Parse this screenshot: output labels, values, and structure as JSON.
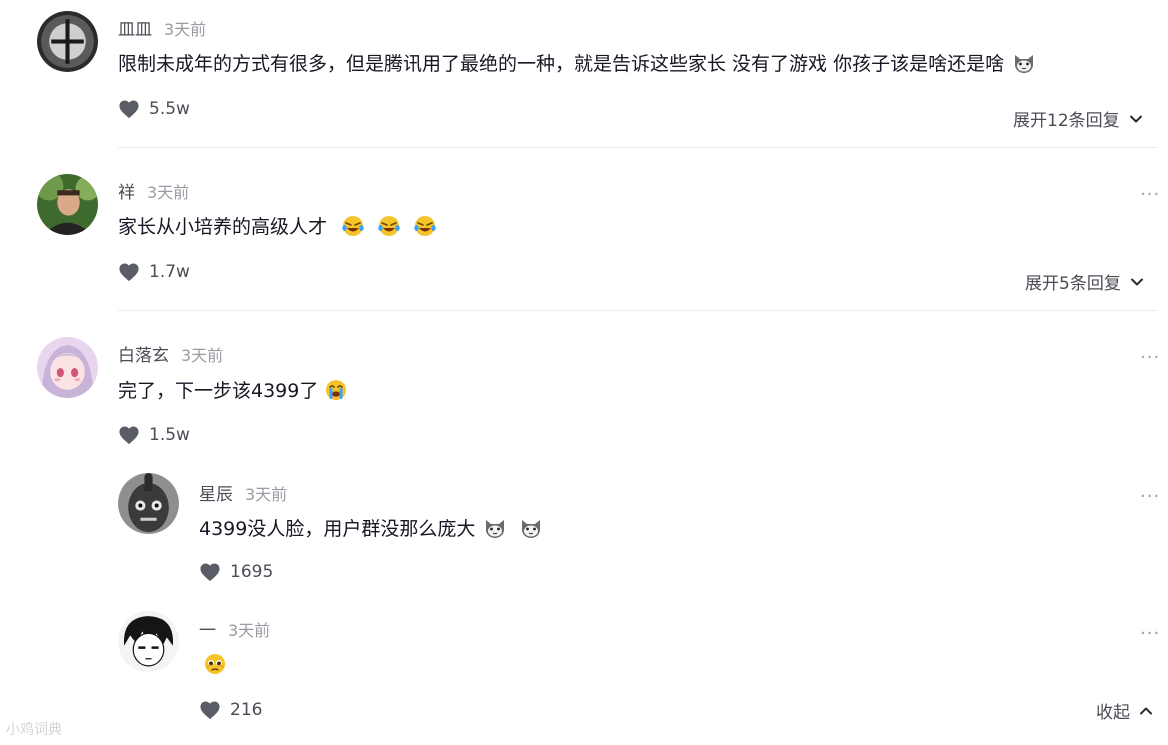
{
  "comments": [
    {
      "username": "皿皿",
      "time": "3天前",
      "text": "限制未成年的方式有很多，但是腾讯用了最绝的一种，就是告诉这些家长 没有了游戏 你孩子该是啥还是啥",
      "emoji": [
        "cat-face-emoji"
      ],
      "likes": "5.5w",
      "expand_label": "展开12条回复"
    },
    {
      "username": "祥",
      "time": "3天前",
      "text": "家长从小培养的高级人才",
      "emoji": [
        "laughing-crying-emoji",
        "laughing-crying-emoji",
        "laughing-crying-emoji"
      ],
      "likes": "1.7w",
      "expand_label": "展开5条回复"
    },
    {
      "username": "白落玄",
      "time": "3天前",
      "text": "完了，下一步该4399了",
      "emoji": [
        "crying-emoji"
      ],
      "likes": "1.5w",
      "replies": [
        {
          "username": "星辰",
          "time": "3天前",
          "text": "4399没人脸，用户群没那么庞大",
          "emoji": [
            "cat-face-emoji",
            "cat-face-emoji"
          ],
          "likes": "1695"
        },
        {
          "username": "一",
          "time": "3天前",
          "text": "",
          "emoji": [
            "pleading-emoji"
          ],
          "likes": "216"
        }
      ],
      "collapse_label": "收起"
    }
  ],
  "more_icon": "···",
  "watermark": "小鸡词典"
}
